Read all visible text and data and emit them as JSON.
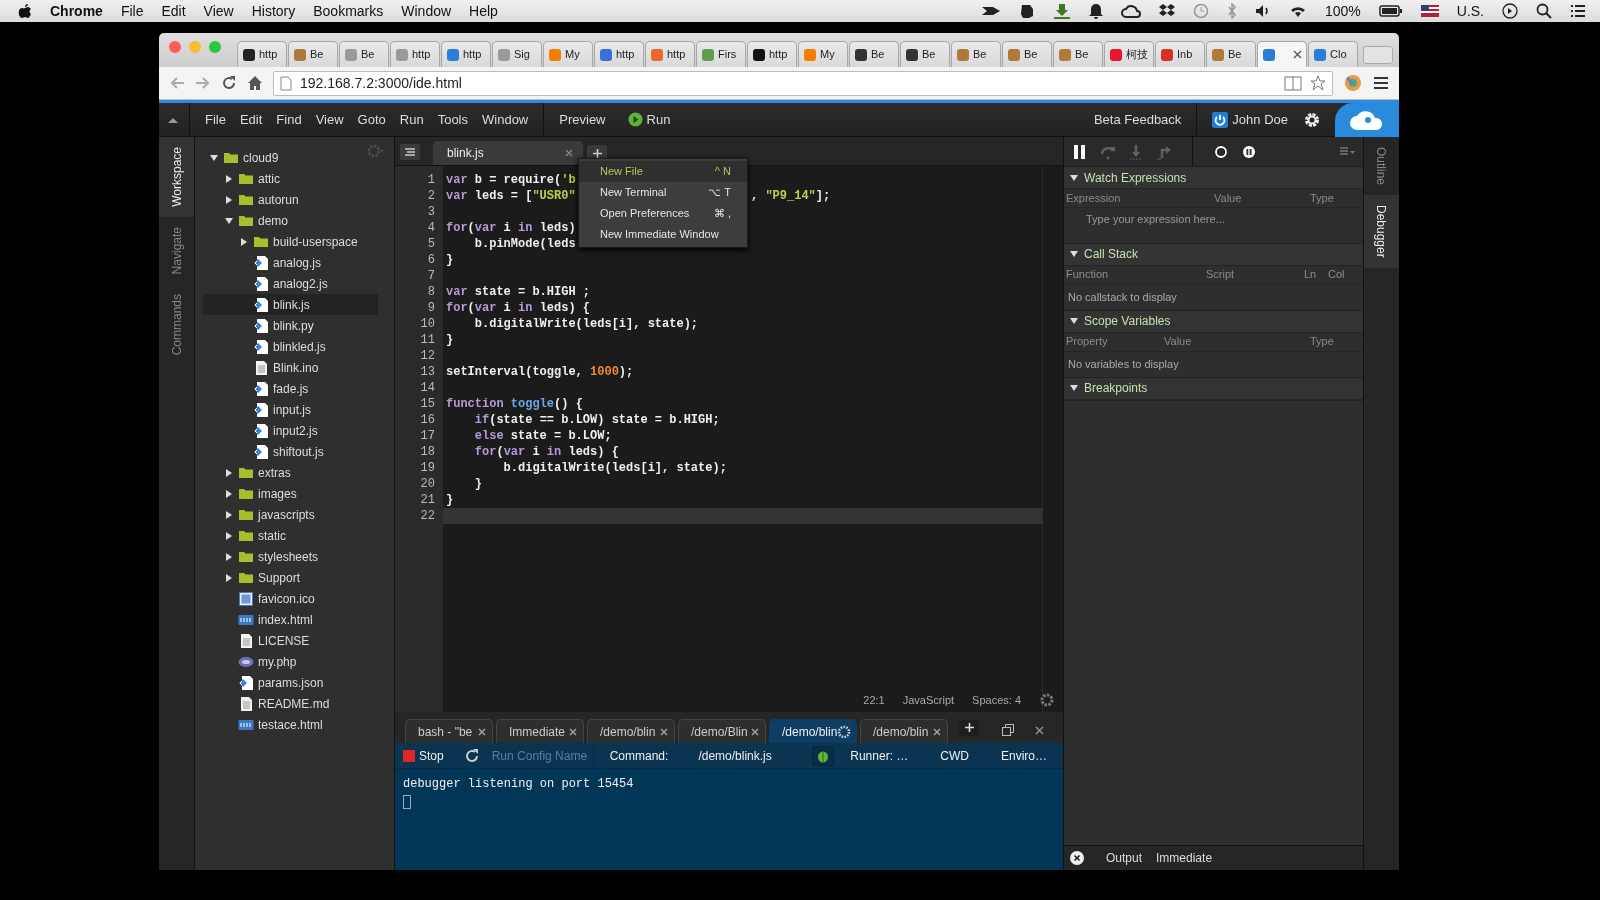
{
  "os_menubar": {
    "app": "Chrome",
    "menus": [
      "File",
      "Edit",
      "View",
      "History",
      "Bookmarks",
      "Window",
      "Help"
    ],
    "battery": "100%",
    "input_source": "U.S."
  },
  "browser": {
    "tabs": [
      {
        "label": "http",
        "color": "#222222",
        "selected": false
      },
      {
        "label": "Be",
        "color": "#b07a3a",
        "selected": false
      },
      {
        "label": "Be",
        "color": "#9a9a9a",
        "selected": false
      },
      {
        "label": "http",
        "color": "#9a9a9a",
        "selected": false
      },
      {
        "label": "http",
        "color": "#2a7fd4",
        "selected": false
      },
      {
        "label": "Sig",
        "color": "#9a9a9a",
        "selected": false
      },
      {
        "label": "My",
        "color": "#f57d00",
        "selected": false
      },
      {
        "label": "http",
        "color": "#3b6fd8",
        "selected": false
      },
      {
        "label": "http",
        "color": "#f06529",
        "selected": false
      },
      {
        "label": "Firs",
        "color": "#5fa04e",
        "selected": false
      },
      {
        "label": "http",
        "color": "#111111",
        "selected": false
      },
      {
        "label": "My",
        "color": "#f57d00",
        "selected": false
      },
      {
        "label": "Be",
        "color": "#333333",
        "selected": false
      },
      {
        "label": "Be",
        "color": "#333333",
        "selected": false
      },
      {
        "label": "Be",
        "color": "#b07a3a",
        "selected": false
      },
      {
        "label": "Be",
        "color": "#b07a3a",
        "selected": false
      },
      {
        "label": "Be",
        "color": "#b07a3a",
        "selected": false
      },
      {
        "label": "柯技",
        "color": "#e6162d",
        "selected": false
      },
      {
        "label": "Inb",
        "color": "#d93025",
        "selected": false
      },
      {
        "label": "Be",
        "color": "#b07a3a",
        "selected": false
      },
      {
        "color": "#2a7fd4",
        "selected": true
      },
      {
        "label": "Clo",
        "color": "#2a7fd4",
        "selected": false
      }
    ],
    "address": "192.168.7.2:3000/ide.html"
  },
  "ide": {
    "menus": [
      "File",
      "Edit",
      "Find",
      "View",
      "Goto",
      "Run",
      "Tools",
      "Window"
    ],
    "preview": "Preview",
    "run": "Run",
    "feedback": "Beta Feedback",
    "user": "John Doe",
    "left_tabs": [
      {
        "label": "Workspace",
        "selected": true
      },
      {
        "label": "Navigate",
        "selected": false
      },
      {
        "label": "Commands",
        "selected": false
      }
    ],
    "file_tree": [
      {
        "name": "cloud9",
        "kind": "folder",
        "expanded": true,
        "selected": false,
        "children": [
          {
            "name": "attic",
            "kind": "folder",
            "expanded": false,
            "selected": false
          },
          {
            "name": "autorun",
            "kind": "folder",
            "expanded": false,
            "selected": false
          },
          {
            "name": "demo",
            "kind": "folder",
            "expanded": true,
            "selected": false,
            "children": [
              {
                "name": "build-userspace",
                "kind": "folder",
                "expanded": false,
                "selected": false
              },
              {
                "name": "analog.js",
                "kind": "script",
                "selected": false
              },
              {
                "name": "analog2.js",
                "kind": "script",
                "selected": false
              },
              {
                "name": "blink.js",
                "kind": "script",
                "selected": true
              },
              {
                "name": "blink.py",
                "kind": "script",
                "selected": false
              },
              {
                "name": "blinkled.js",
                "kind": "script",
                "selected": false
              },
              {
                "name": "Blink.ino",
                "kind": "text",
                "selected": false
              },
              {
                "name": "fade.js",
                "kind": "script",
                "selected": false
              },
              {
                "name": "input.js",
                "kind": "script",
                "selected": false
              },
              {
                "name": "input2.js",
                "kind": "script",
                "selected": false
              },
              {
                "name": "shiftout.js",
                "kind": "script",
                "selected": false
              }
            ]
          },
          {
            "name": "extras",
            "kind": "folder",
            "expanded": false,
            "selected": false
          },
          {
            "name": "images",
            "kind": "folder",
            "expanded": false,
            "selected": false
          },
          {
            "name": "javascripts",
            "kind": "folder",
            "expanded": false,
            "selected": false
          },
          {
            "name": "static",
            "kind": "folder",
            "expanded": false,
            "selected": false
          },
          {
            "name": "stylesheets",
            "kind": "folder",
            "expanded": false,
            "selected": false
          },
          {
            "name": "Support",
            "kind": "folder",
            "expanded": false,
            "selected": false
          },
          {
            "name": "favicon.ico",
            "kind": "image",
            "selected": false
          },
          {
            "name": "index.html",
            "kind": "html",
            "selected": false
          },
          {
            "name": "LICENSE",
            "kind": "text",
            "selected": false
          },
          {
            "name": "my.php",
            "kind": "php",
            "selected": false
          },
          {
            "name": "params.json",
            "kind": "script",
            "selected": false
          },
          {
            "name": "README.md",
            "kind": "text",
            "selected": false
          },
          {
            "name": "testace.html",
            "kind": "html",
            "selected": false
          }
        ]
      }
    ],
    "editor": {
      "tabs": [
        {
          "label": "blink.js",
          "selected": true
        }
      ],
      "lines": [
        {
          "number": "1",
          "current": false,
          "parts": [
            [
              {
                "kind": "keyword",
                "text": "var"
              },
              {
                "kind": "plain",
                "text": " b = require("
              },
              {
                "kind": "string",
                "text": "'b"
              }
            ]
          ]
        },
        {
          "number": "2",
          "current": false,
          "parts": [
            [
              {
                "kind": "keyword",
                "text": "var"
              },
              {
                "kind": "plain",
                "text": " leds = ["
              },
              {
                "kind": "string",
                "text": "\"USR0\""
              }
            ],
            [
              {
                "kind": "plain",
                "text": ", "
              },
              {
                "kind": "string",
                "text": "\"P9_14\""
              },
              {
                "kind": "plain",
                "text": "];"
              }
            ]
          ]
        },
        {
          "number": "3",
          "current": false
        },
        {
          "number": "4",
          "current": false,
          "parts": [
            [
              {
                "kind": "keyword",
                "text": "for"
              },
              {
                "kind": "plain",
                "text": "("
              },
              {
                "kind": "keyword",
                "text": "var"
              },
              {
                "kind": "plain",
                "text": " i "
              },
              {
                "kind": "keyword",
                "text": "in"
              },
              {
                "kind": "plain",
                "text": " leds)"
              }
            ]
          ]
        },
        {
          "number": "5",
          "current": false,
          "parts": [
            [
              {
                "kind": "plain",
                "text": "    b.pinMode(leds"
              }
            ]
          ]
        },
        {
          "number": "6",
          "current": false,
          "parts": [
            [
              {
                "kind": "plain",
                "text": "}"
              }
            ]
          ]
        },
        {
          "number": "7",
          "current": false
        },
        {
          "number": "8",
          "current": false,
          "parts": [
            [
              {
                "kind": "keyword",
                "text": "var"
              },
              {
                "kind": "plain",
                "text": " state = b.HIGH ;"
              }
            ]
          ]
        },
        {
          "number": "9",
          "current": false,
          "parts": [
            [
              {
                "kind": "keyword",
                "text": "for"
              },
              {
                "kind": "plain",
                "text": "("
              },
              {
                "kind": "keyword",
                "text": "var"
              },
              {
                "kind": "plain",
                "text": " i "
              },
              {
                "kind": "keyword",
                "text": "in"
              },
              {
                "kind": "plain",
                "text": " leds) {"
              }
            ]
          ]
        },
        {
          "number": "10",
          "current": false,
          "parts": [
            [
              {
                "kind": "plain",
                "text": "    b.digitalWrite(leds[i], state);"
              }
            ]
          ]
        },
        {
          "number": "11",
          "current": false,
          "parts": [
            [
              {
                "kind": "plain",
                "text": "}"
              }
            ]
          ]
        },
        {
          "number": "12",
          "current": false
        },
        {
          "number": "13",
          "current": false,
          "parts": [
            [
              {
                "kind": "plain",
                "text": "setInterval(toggle, "
              },
              {
                "kind": "number",
                "text": "1000"
              },
              {
                "kind": "plain",
                "text": ");"
              }
            ]
          ]
        },
        {
          "number": "14",
          "current": false
        },
        {
          "number": "15",
          "current": false,
          "parts": [
            [
              {
                "kind": "keyword",
                "text": "function"
              },
              {
                "kind": "function",
                "text": " toggle"
              },
              {
                "kind": "plain",
                "text": "() {"
              }
            ]
          ]
        },
        {
          "number": "16",
          "current": false,
          "parts": [
            [
              {
                "kind": "keyword",
                "text": "    if"
              },
              {
                "kind": "plain",
                "text": "(state == b.LOW) state = b.HIGH;"
              }
            ]
          ]
        },
        {
          "number": "17",
          "current": false,
          "parts": [
            [
              {
                "kind": "keyword",
                "text": "    else"
              },
              {
                "kind": "plain",
                "text": " state = b.LOW;"
              }
            ]
          ]
        },
        {
          "number": "18",
          "current": false,
          "parts": [
            [
              {
                "kind": "keyword",
                "text": "    for"
              },
              {
                "kind": "plain",
                "text": "("
              },
              {
                "kind": "keyword",
                "text": "var"
              },
              {
                "kind": "plain",
                "text": " i "
              },
              {
                "kind": "keyword",
                "text": "in"
              },
              {
                "kind": "plain",
                "text": " leds) {"
              }
            ]
          ]
        },
        {
          "number": "19",
          "current": false,
          "parts": [
            [
              {
                "kind": "plain",
                "text": "        b.digitalWrite(leds[i], state);"
              }
            ]
          ]
        },
        {
          "number": "20",
          "current": false,
          "parts": [
            [
              {
                "kind": "plain",
                "text": "    }"
              }
            ]
          ]
        },
        {
          "number": "21",
          "current": false,
          "parts": [
            [
              {
                "kind": "plain",
                "text": "}"
              }
            ]
          ]
        },
        {
          "number": "22",
          "current": true
        }
      ],
      "cursor": "22:1",
      "language": "JavaScript",
      "indent": "Spaces: 4"
    },
    "new_menu": [
      {
        "label": "New File",
        "shortcut": "^ N",
        "selected": true
      },
      {
        "label": "New Terminal",
        "shortcut": "⌥ T",
        "selected": false
      },
      {
        "label": "Open Preferences",
        "shortcut": "⌘ ,",
        "selected": false
      },
      {
        "label": "New Immediate Window",
        "selected": false
      }
    ],
    "bottom_panel": {
      "tabs": [
        {
          "label": "bash - \"be",
          "selected": false,
          "busy": false
        },
        {
          "label": "Immediate",
          "selected": false,
          "busy": false
        },
        {
          "label": "/demo/blin",
          "selected": false,
          "busy": false
        },
        {
          "label": "/demo/Blin",
          "selected": false,
          "busy": false
        },
        {
          "label": "/demo/blin",
          "selected": true,
          "busy": true
        },
        {
          "label": "/demo/blin",
          "selected": false,
          "busy": false
        }
      ],
      "stop": "Stop",
      "run_config": {
        "placeholder": "Run Config Name"
      },
      "command_label": "Command:",
      "command": "/demo/blink.js",
      "runner": "Runner: …",
      "cwd": "CWD",
      "env": "Enviro…",
      "console": [
        "debugger listening on port 15454"
      ]
    },
    "debugger": {
      "controls": [
        {
          "kind": "pause",
          "disabled": false
        },
        {
          "kind": "step-over",
          "disabled": true
        },
        {
          "kind": "step-into",
          "disabled": true
        },
        {
          "kind": "step-out",
          "disabled": true
        },
        {
          "kind": "breakpoints",
          "disabled": false
        },
        {
          "kind": "pause-exceptions",
          "disabled": false
        }
      ],
      "sections": [
        {
          "title": "Watch Expressions",
          "expanded": true,
          "columns": [
            "Expression",
            "Value",
            "Type"
          ],
          "placeholder": "Type your expression here..."
        },
        {
          "title": "Call Stack",
          "expanded": true,
          "columns": [
            "Function",
            "Script",
            "Ln",
            "Col"
          ],
          "message": "No callstack to display"
        },
        {
          "title": "Scope Variables",
          "expanded": true,
          "columns": [
            "Property",
            "Value",
            "Type"
          ],
          "message": "No variables to display"
        },
        {
          "title": "Breakpoints",
          "expanded": true
        }
      ],
      "bottom_tabs": [
        "Output",
        "Immediate"
      ]
    },
    "right_tabs": [
      {
        "label": "Outline",
        "selected": false
      },
      {
        "label": "Debugger",
        "selected": true
      }
    ]
  }
}
